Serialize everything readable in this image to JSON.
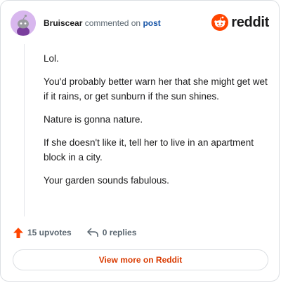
{
  "header": {
    "username": "Bruiscear",
    "commented_on": "commented on",
    "post_link": "post",
    "logo_text": "reddit"
  },
  "comment": {
    "paragraphs": [
      "Lol.",
      "You'd probably better warn her that she might get wet if it rains, or get sunburn if the sun shines.",
      "Nature is gonna nature.",
      "If she doesn't like it, tell her to live in an apartment block in a city.",
      "Your garden sounds fabulous."
    ]
  },
  "actions": {
    "upvotes": "15 upvotes",
    "replies": "0 replies"
  },
  "footer": {
    "view_more": "View more on Reddit"
  },
  "colors": {
    "brand": "#ff4500",
    "link": "#1553a6",
    "view_more": "#d93a00"
  }
}
